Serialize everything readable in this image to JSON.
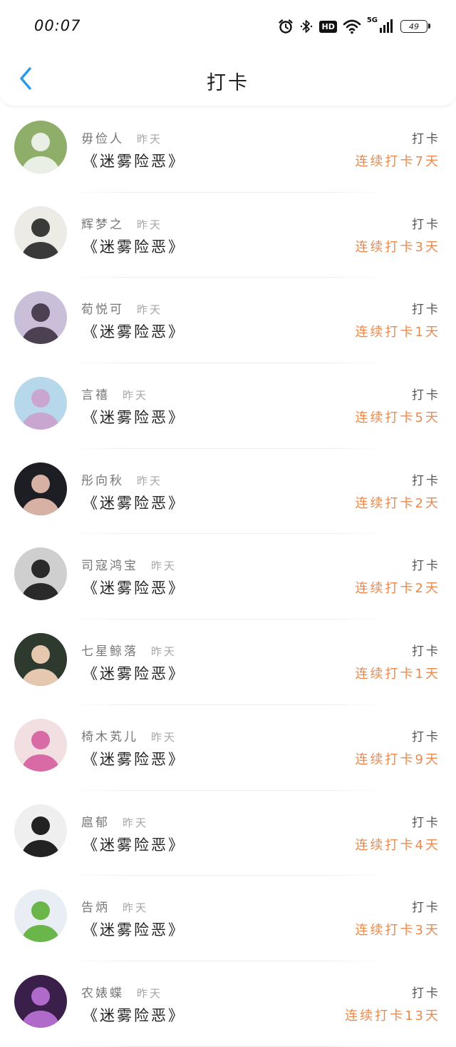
{
  "status_bar": {
    "time": "00:07",
    "hd_label": "HD",
    "network_label": "5G",
    "battery_level": "49"
  },
  "header": {
    "title": "打卡"
  },
  "checkins": [
    {
      "name": "毋俭人",
      "time": "昨天",
      "book": "《迷雾险恶》",
      "action": "打卡",
      "streak": "连续打卡7天",
      "avatar_colors": [
        "#8fae6a",
        "#e9efe4"
      ]
    },
    {
      "name": "辉梦之",
      "time": "昨天",
      "book": "《迷雾险恶》",
      "action": "打卡",
      "streak": "连续打卡3天",
      "avatar_colors": [
        "#ecebe6",
        "#3a3a3a"
      ]
    },
    {
      "name": "荀悦可",
      "time": "昨天",
      "book": "《迷雾险恶》",
      "action": "打卡",
      "streak": "连续打卡1天",
      "avatar_colors": [
        "#c9bfd9",
        "#4b4150"
      ]
    },
    {
      "name": "言禧",
      "time": "昨天",
      "book": "《迷雾险恶》",
      "action": "打卡",
      "streak": "连续打卡5天",
      "avatar_colors": [
        "#b7d8ea",
        "#c9a6cf"
      ]
    },
    {
      "name": "彤向秋",
      "time": "昨天",
      "book": "《迷雾险恶》",
      "action": "打卡",
      "streak": "连续打卡2天",
      "avatar_colors": [
        "#1d1d24",
        "#d7b2a4"
      ]
    },
    {
      "name": "司寇鸿宝",
      "time": "昨天",
      "book": "《迷雾险恶》",
      "action": "打卡",
      "streak": "连续打卡2天",
      "avatar_colors": [
        "#cfcfcf",
        "#2a2a2a"
      ]
    },
    {
      "name": "七星鲸落",
      "time": "昨天",
      "book": "《迷雾险恶》",
      "action": "打卡",
      "streak": "连续打卡1天",
      "avatar_colors": [
        "#2e3a2e",
        "#e6c8b0"
      ]
    },
    {
      "name": "椅木芄儿",
      "time": "昨天",
      "book": "《迷雾险恶》",
      "action": "打卡",
      "streak": "连续打卡9天",
      "avatar_colors": [
        "#f1dfe2",
        "#d86aa6"
      ]
    },
    {
      "name": "扈郁",
      "time": "昨天",
      "book": "《迷雾险恶》",
      "action": "打卡",
      "streak": "连续打卡4天",
      "avatar_colors": [
        "#efefef",
        "#222222"
      ]
    },
    {
      "name": "告炳",
      "time": "昨天",
      "book": "《迷雾险恶》",
      "action": "打卡",
      "streak": "连续打卡3天",
      "avatar_colors": [
        "#e8eef3",
        "#6bb64a"
      ]
    },
    {
      "name": "农婊蝶",
      "time": "昨天",
      "book": "《迷雾险恶》",
      "action": "打卡",
      "streak": "连续打卡13天",
      "avatar_colors": [
        "#3a1f4a",
        "#b06ac9"
      ]
    }
  ]
}
